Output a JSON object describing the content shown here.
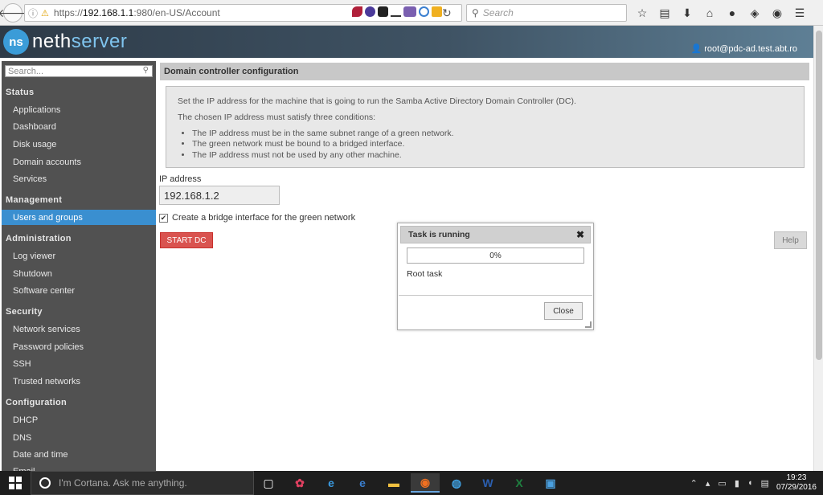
{
  "browser": {
    "url_prefix": "https://",
    "url_host": "192.168.1.1",
    "url_rest": ":980/en-US/Account",
    "search_placeholder": "Search"
  },
  "header": {
    "logo_mark": "ns",
    "logo_neth": "neth",
    "logo_server": "server",
    "user": "root@pdc-ad.test.abt.ro"
  },
  "sidebar": {
    "search_placeholder": "Search...",
    "sections": [
      {
        "title": "Status",
        "items": [
          "Applications",
          "Dashboard",
          "Disk usage",
          "Domain accounts",
          "Services"
        ]
      },
      {
        "title": "Management",
        "items": [
          "Users and groups"
        ]
      },
      {
        "title": "Administration",
        "items": [
          "Log viewer",
          "Shutdown",
          "Software center"
        ]
      },
      {
        "title": "Security",
        "items": [
          "Network services",
          "Password policies",
          "SSH",
          "Trusted networks"
        ]
      },
      {
        "title": "Configuration",
        "items": [
          "DHCP",
          "DNS",
          "Date and time",
          "Email"
        ]
      }
    ],
    "active_item": "Users and groups"
  },
  "main": {
    "title": "Domain controller configuration",
    "info_p1": "Set the IP address for the machine that is going to run the Samba Active Directory Domain Controller (DC).",
    "info_p2": "The chosen IP address must satisfy three conditions:",
    "conditions": [
      "The IP address must be in the same subnet range of a green network.",
      "The green network must be bound to a bridged interface.",
      "The IP address must not be used by any other machine."
    ],
    "ip_label": "IP address",
    "ip_value": "192.168.1.2",
    "bridge_label": "Create a bridge interface for the green network",
    "bridge_checked": true,
    "start_button": "START DC",
    "help_button": "Help"
  },
  "dialog": {
    "title": "Task is running",
    "progress_text": "0%",
    "progress_value": 0,
    "task_name": "Root task",
    "close_button": "Close",
    "close_x": "✖"
  },
  "taskbar": {
    "cortana_text": "I'm Cortana. Ask me anything.",
    "time": "19:23",
    "date": "07/29/2016"
  },
  "colors": {
    "accent": "#3a8fd0",
    "danger": "#d9534f",
    "sidebar_bg": "#515151"
  }
}
